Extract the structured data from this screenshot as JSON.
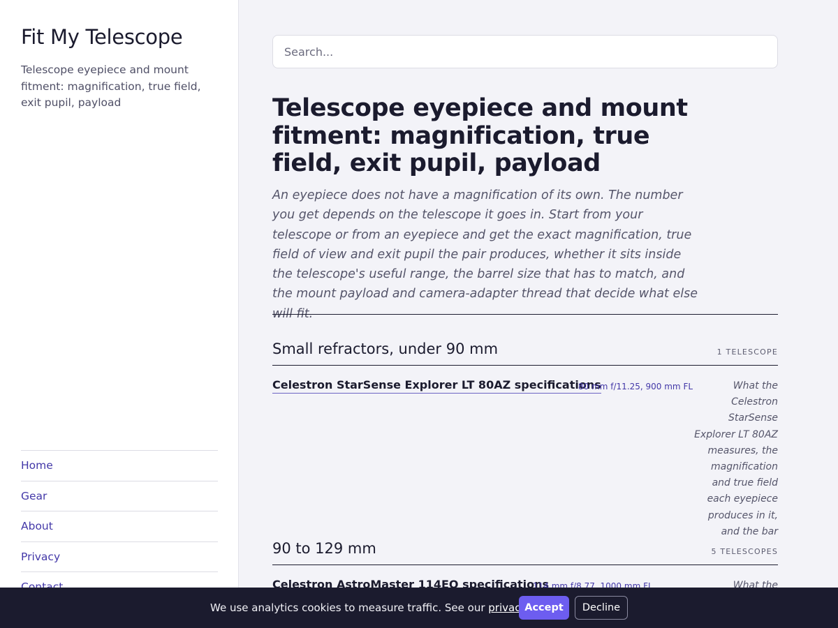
{
  "sidebar": {
    "site_title": "Fit My Telescope",
    "tagline": "Telescope eyepiece and mount fitment: magnification, true field, exit pupil, payload",
    "nav": [
      {
        "label": "Home"
      },
      {
        "label": "Gear"
      },
      {
        "label": "About"
      },
      {
        "label": "Privacy"
      },
      {
        "label": "Contact"
      }
    ]
  },
  "search": {
    "placeholder": "Search..."
  },
  "page": {
    "title": "Telescope eyepiece and mount fitment: magnification, true field, exit pupil, payload",
    "intro": "An eyepiece does not have a magnification of its own. The number you get depends on the telescope it goes in. Start from your telescope or from an eyepiece and get the exact magnification, true field of view and exit pupil the pair produces, whether it sits inside the telescope's useful range, the barrel size that has to match, and the mount payload and camera-adapter thread that decide what else will fit."
  },
  "sections": [
    {
      "heading": "Small refractors, under 90 mm",
      "count": "1 TELESCOPE",
      "entries": [
        {
          "title": "Celestron StarSense Explorer LT 80AZ specifications",
          "specs": "80 mm f/11.25, 900 mm FL",
          "desc": "What the Celestron StarSense Explorer LT 80AZ measures, the magnification and true field each eyepiece produces in it, and the bar"
        }
      ]
    },
    {
      "heading": "90 to 129 mm",
      "count": "5 TELESCOPES",
      "entries": [
        {
          "title": "Celestron AstroMaster 114EQ specifications",
          "specs": "114 mm f/8.77, 1000 mm FL",
          "desc": "What the Celestron"
        }
      ]
    }
  ],
  "cookie": {
    "text_before": "We use analytics cookies to measure traffic. See our ",
    "link": "privacy notice",
    "text_after": ".",
    "accept": "Accept",
    "decline": "Decline"
  }
}
